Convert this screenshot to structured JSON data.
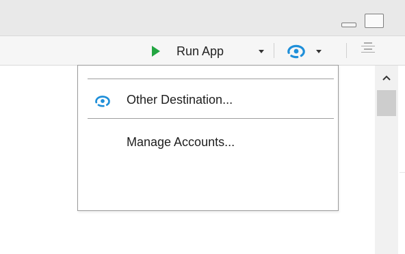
{
  "toolbar": {
    "run_app_label": "Run App"
  },
  "menu": {
    "items": [
      {
        "label": "Other Destination...",
        "icon": "publish-icon"
      },
      {
        "label": "Manage Accounts...",
        "icon": null
      }
    ]
  },
  "icons": {
    "run": "play-icon",
    "publish": "publish-icon",
    "outline": "document-outline-icon"
  },
  "colors": {
    "run_green": "#22a541",
    "publish_blue": "#1f8fd9"
  }
}
